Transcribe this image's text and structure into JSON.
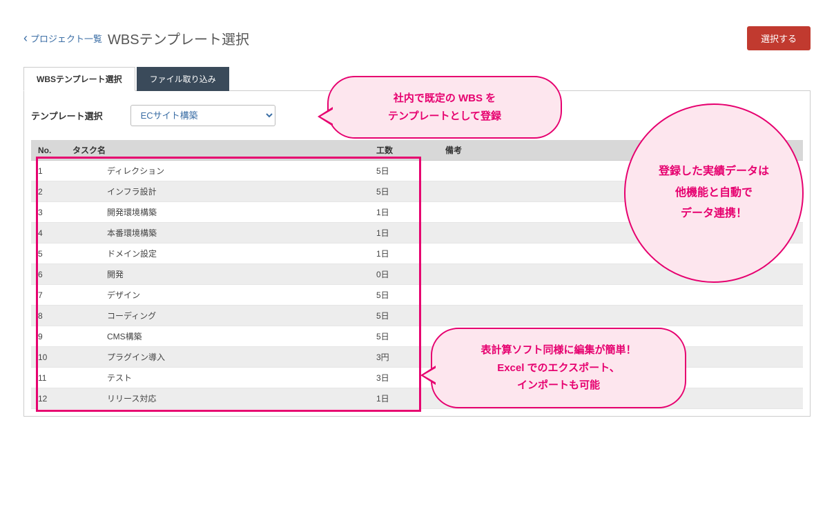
{
  "header": {
    "breadcrumb": "プロジェクト一覧",
    "title": "WBSテンプレート選択",
    "select_button": "選択する"
  },
  "tabs": {
    "tab1": "WBSテンプレート選択",
    "tab2": "ファイル取り込み"
  },
  "template_select": {
    "label": "テンプレート選択",
    "value": "ECサイト構築"
  },
  "table": {
    "headers": {
      "no": "No.",
      "task": "タスク名",
      "effort": "工数",
      "remarks": "備考"
    },
    "rows": [
      {
        "no": "1",
        "task": "ディレクション",
        "effort": "5日",
        "remarks": ""
      },
      {
        "no": "2",
        "task": "インフラ設計",
        "effort": "5日",
        "remarks": ""
      },
      {
        "no": "3",
        "task": "開発環境構築",
        "effort": "1日",
        "remarks": ""
      },
      {
        "no": "4",
        "task": "本番環境構築",
        "effort": "1日",
        "remarks": ""
      },
      {
        "no": "5",
        "task": "ドメイン設定",
        "effort": "1日",
        "remarks": ""
      },
      {
        "no": "6",
        "task": "開発",
        "effort": "0日",
        "remarks": ""
      },
      {
        "no": "7",
        "task": "デザイン",
        "effort": "5日",
        "remarks": ""
      },
      {
        "no": "8",
        "task": "コーディング",
        "effort": "5日",
        "remarks": ""
      },
      {
        "no": "9",
        "task": "CMS構築",
        "effort": "5日",
        "remarks": ""
      },
      {
        "no": "10",
        "task": "プラグイン導入",
        "effort": "3円",
        "remarks": ""
      },
      {
        "no": "11",
        "task": "テスト",
        "effort": "3日",
        "remarks": ""
      },
      {
        "no": "12",
        "task": "リリース対応",
        "effort": "1日",
        "remarks": ""
      }
    ]
  },
  "callouts": {
    "c1_line1": "社内で既定の WBS を",
    "c1_line2": "テンプレートとして登録",
    "c2_line1": "登録した実績データは",
    "c2_line2": "他機能と自動で",
    "c2_line3": "データ連携！",
    "c3_line1": "表計算ソフト同様に編集が簡単！",
    "c3_line2": "Excel でのエクスポート、",
    "c3_line3": "インポートも可能"
  }
}
